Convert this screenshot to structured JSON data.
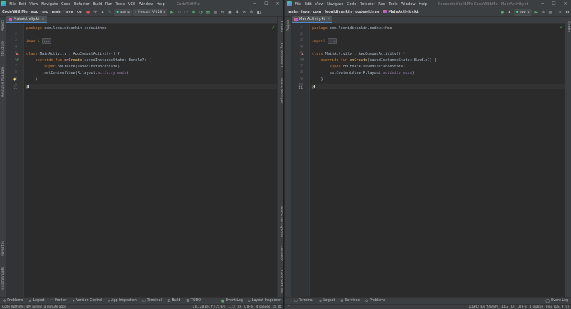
{
  "colors": {
    "background": "#2b2b2b",
    "chrome": "#3c3f41",
    "keyword": "#cc7832",
    "function": "#ffc66d",
    "field": "#9876aa",
    "text": "#a9b7c6",
    "tab_accent": "#4a88c7",
    "ok_green": "#499c54"
  },
  "left": {
    "menu": [
      "File",
      "Edit",
      "View",
      "Navigate",
      "Code",
      "Refactor",
      "Build",
      "Run",
      "Tools",
      "VCS",
      "Window",
      "Help"
    ],
    "title": "CodeWithMe",
    "breadcrumbs": [
      "CodeWithMe",
      "app",
      "src",
      "main",
      "java",
      "co"
    ],
    "toolbar": {
      "config": "app",
      "device": "Nexus4 API 28"
    },
    "left_tools": [
      "Project",
      "Structure",
      "Resource Manager",
      "Favorites",
      "Build Variants"
    ],
    "right_tools": [
      "Gradle",
      "Key Promoter X",
      "Device Manager",
      "Device File Explorer",
      "Emulator",
      "Code With Me"
    ],
    "tab": "MainActivity.kt",
    "bottom_tools": [
      "Problems",
      "Logcat",
      "Profiler",
      "Version Control",
      "App Inspection",
      "Terminal",
      "Build",
      "TODO",
      "Event Log",
      "Layout Inspector"
    ],
    "status_message": "Code With Me: ILM joined (a minute ago)",
    "status": {
      "net": "↓0.128 B/s ↑215 B/s",
      "pos": "11:2",
      "lf": "LF",
      "enc": "UTF-8",
      "indent": "4 spaces"
    }
  },
  "right": {
    "menu": [
      "File",
      "Edit",
      "View",
      "Navigate",
      "Code",
      "Refactor",
      "Run",
      "Tools",
      "Window",
      "Help"
    ],
    "title": "Connected to ILM's CodeWithMe - MainActivity.kt",
    "breadcrumbs": [
      "main",
      "java",
      "com",
      "leonidivankin",
      "codewithme"
    ],
    "breadcrumb_file": "MainActivity.kt",
    "toolbar": {
      "config": "app"
    },
    "left_tools": [
      "Project"
    ],
    "right_tools": [
      "Gradle"
    ],
    "tab": "MainActivity.kt",
    "bottom_tools": [
      "Terminal",
      "Logcat",
      "Services",
      "Problems",
      "Event Log"
    ],
    "status": {
      "net": "↓1302 B/s ↑49 B/s",
      "pos": "11:2",
      "lf": "LF",
      "enc": "UTF-8",
      "indent": "4 spaces",
      "ping": "Ping (US) 9 (0)"
    }
  },
  "code": {
    "line_numbers": [
      "1",
      "2",
      "3",
      "4",
      "5",
      "6",
      "7",
      "8",
      "9",
      "10",
      "11"
    ],
    "package_kw": "package",
    "package_name": "com.leonidivankin.codewithme",
    "import_kw": "import",
    "import_fold": "...",
    "class_kw": "class",
    "class_decl": "MainActivity : AppCompatActivity() {",
    "override_kw": "override fun",
    "fun_name": "onCreate",
    "fun_params": "(savedInstanceState: Bundle?) {",
    "super_kw": "super",
    "super_call": ".onCreate(savedInstanceState)",
    "set_call_pre": "setContentView(R.layout.",
    "layout_field": "activity_main",
    "set_call_post": ")",
    "close_inner": "}",
    "close_outer": "}"
  }
}
